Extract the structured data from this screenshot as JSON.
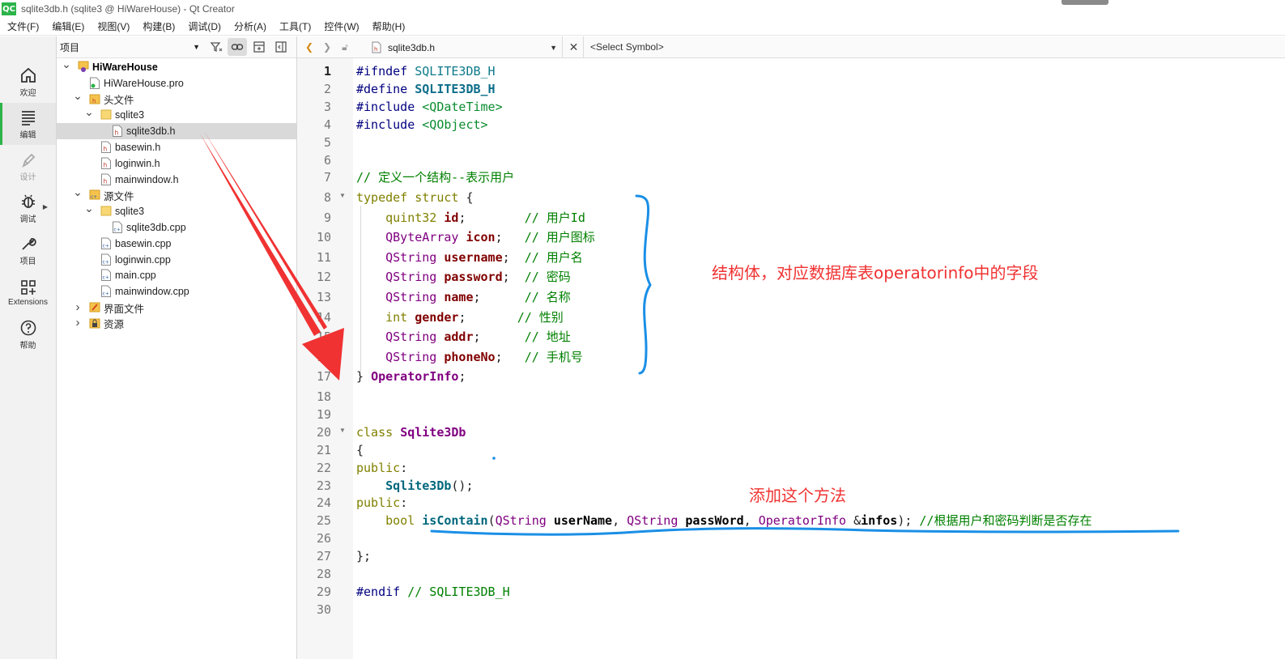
{
  "window": {
    "app_icon": "QC",
    "title": "sqlite3db.h (sqlite3 @ HiWareHouse) - Qt Creator"
  },
  "menu": [
    "文件(F)",
    "编辑(E)",
    "视图(V)",
    "构建(B)",
    "调试(D)",
    "分析(A)",
    "工具(T)",
    "控件(W)",
    "帮助(H)"
  ],
  "modes": [
    {
      "label": "欢迎",
      "icon": "home-icon"
    },
    {
      "label": "编辑",
      "icon": "edit-lines-icon",
      "active": true
    },
    {
      "label": "设计",
      "icon": "pen-icon",
      "disabled": true
    },
    {
      "label": "调试",
      "icon": "bug-icon"
    },
    {
      "label": "项目",
      "icon": "wrench-icon"
    },
    {
      "label": "Extensions",
      "icon": "extensions-grid-icon"
    },
    {
      "label": "帮助",
      "icon": "help-icon"
    }
  ],
  "project_panel": {
    "view_selector": "项目",
    "tree": [
      {
        "label": "HiWareHouse",
        "depth": 0,
        "expanded": true,
        "bold": true,
        "icon": "project-icon"
      },
      {
        "label": "HiWareHouse.pro",
        "depth": 1,
        "icon": "pro-file-icon"
      },
      {
        "label": "头文件",
        "depth": 1,
        "expanded": true,
        "icon": "header-folder-icon"
      },
      {
        "label": "sqlite3",
        "depth": 2,
        "expanded": true,
        "icon": "folder-icon"
      },
      {
        "label": "sqlite3db.h",
        "depth": 3,
        "selected": true,
        "icon": "header-file-icon"
      },
      {
        "label": "basewin.h",
        "depth": 2,
        "icon": "header-file-icon"
      },
      {
        "label": "loginwin.h",
        "depth": 2,
        "icon": "header-file-icon"
      },
      {
        "label": "mainwindow.h",
        "depth": 2,
        "icon": "header-file-icon"
      },
      {
        "label": "源文件",
        "depth": 1,
        "expanded": true,
        "icon": "source-folder-icon"
      },
      {
        "label": "sqlite3",
        "depth": 2,
        "expanded": true,
        "icon": "folder-icon"
      },
      {
        "label": "sqlite3db.cpp",
        "depth": 3,
        "icon": "cpp-file-icon"
      },
      {
        "label": "basewin.cpp",
        "depth": 2,
        "icon": "cpp-file-icon"
      },
      {
        "label": "loginwin.cpp",
        "depth": 2,
        "icon": "cpp-file-icon"
      },
      {
        "label": "main.cpp",
        "depth": 2,
        "icon": "cpp-file-icon"
      },
      {
        "label": "mainwindow.cpp",
        "depth": 2,
        "icon": "cpp-file-icon"
      },
      {
        "label": "界面文件",
        "depth": 1,
        "expanded": false,
        "icon": "forms-folder-icon"
      },
      {
        "label": "资源",
        "depth": 1,
        "expanded": false,
        "icon": "resources-folder-icon"
      }
    ]
  },
  "editor_toolbar": {
    "file": "sqlite3db.h",
    "symbol": "<Select Symbol>"
  },
  "code": {
    "current_line": 1,
    "lines": [
      [
        [
          "pp",
          "#ifndef "
        ],
        [
          "ppv",
          "SQLITE3DB_H"
        ]
      ],
      [
        [
          "pp",
          "#define "
        ],
        [
          "ppdef",
          "SQLITE3DB_H"
        ]
      ],
      [
        [
          "pp",
          "#include "
        ],
        [
          "inc",
          "<QDateTime>"
        ]
      ],
      [
        [
          "pp",
          "#include "
        ],
        [
          "inc",
          "<QObject>"
        ]
      ],
      [],
      [],
      [
        [
          "cm",
          "// 定义一个结构--表示用户"
        ]
      ],
      [
        [
          "kw",
          "typedef struct "
        ],
        [
          "t",
          "{"
        ]
      ],
      [
        [
          "t",
          "    "
        ],
        [
          "kw",
          "quint32 "
        ],
        [
          "fld",
          "id"
        ],
        [
          "t",
          ";        "
        ],
        [
          "cm",
          "// 用户Id"
        ]
      ],
      [
        [
          "t",
          "    "
        ],
        [
          "tp",
          "QByteArray "
        ],
        [
          "fld",
          "icon"
        ],
        [
          "t",
          ";   "
        ],
        [
          "cm",
          "// 用户图标"
        ]
      ],
      [
        [
          "t",
          "    "
        ],
        [
          "tp",
          "QString "
        ],
        [
          "fld",
          "username"
        ],
        [
          "t",
          ";  "
        ],
        [
          "cm",
          "// 用户名"
        ]
      ],
      [
        [
          "t",
          "    "
        ],
        [
          "tp",
          "QString "
        ],
        [
          "fld",
          "password"
        ],
        [
          "t",
          ";  "
        ],
        [
          "cm",
          "// 密码"
        ]
      ],
      [
        [
          "t",
          "    "
        ],
        [
          "tp",
          "QString "
        ],
        [
          "fld",
          "name"
        ],
        [
          "t",
          ";      "
        ],
        [
          "cm",
          "// 名称"
        ]
      ],
      [
        [
          "t",
          "    "
        ],
        [
          "kw",
          "int "
        ],
        [
          "fld",
          "gender"
        ],
        [
          "t",
          ";       "
        ],
        [
          "cm",
          "// 性别"
        ]
      ],
      [
        [
          "t",
          "    "
        ],
        [
          "tp",
          "QString "
        ],
        [
          "fld",
          "addr"
        ],
        [
          "t",
          ";      "
        ],
        [
          "cm",
          "// 地址"
        ]
      ],
      [
        [
          "t",
          "    "
        ],
        [
          "tp",
          "QString "
        ],
        [
          "fld",
          "phoneNo"
        ],
        [
          "t",
          ";   "
        ],
        [
          "cm",
          "// 手机号"
        ]
      ],
      [
        [
          "t",
          "} "
        ],
        [
          "cls",
          "OperatorInfo"
        ],
        [
          "t",
          ";"
        ]
      ],
      [],
      [],
      [
        [
          "kw",
          "class "
        ],
        [
          "cls",
          "Sqlite3Db"
        ]
      ],
      [
        [
          "t",
          "{"
        ]
      ],
      [
        [
          "kw",
          "public"
        ],
        [
          "t",
          ":"
        ]
      ],
      [
        [
          "t",
          "    "
        ],
        [
          "fn",
          "Sqlite3Db"
        ],
        [
          "t",
          "();"
        ]
      ],
      [
        [
          "kw",
          "public"
        ],
        [
          "t",
          ":"
        ]
      ],
      [
        [
          "t",
          "    "
        ],
        [
          "kw",
          "bool "
        ],
        [
          "fn",
          "isContain"
        ],
        [
          "t",
          "("
        ],
        [
          "tp",
          "QString "
        ],
        [
          "bold",
          "userName"
        ],
        [
          "t",
          ", "
        ],
        [
          "tp",
          "QString "
        ],
        [
          "bold",
          "passWord"
        ],
        [
          "t",
          ", "
        ],
        [
          "tp",
          "OperatorInfo "
        ],
        [
          "t",
          "&"
        ],
        [
          "bold",
          "infos"
        ],
        [
          "t",
          "); "
        ],
        [
          "cm",
          "//根据用户和密码判断是否存在"
        ]
      ],
      [],
      [
        [
          "t",
          "};"
        ]
      ],
      [],
      [
        [
          "pp",
          "#endif "
        ],
        [
          "cm",
          "// SQLITE3DB_H"
        ]
      ],
      []
    ]
  },
  "annotations": {
    "struct_note": "结构体，对应数据库表operatorinfo中的字段",
    "method_note": "添加这个方法"
  },
  "colors": {
    "accent_green": "#2cb34a",
    "annotation_red": "#f03232",
    "annotation_blue": "#1a8fe6"
  }
}
